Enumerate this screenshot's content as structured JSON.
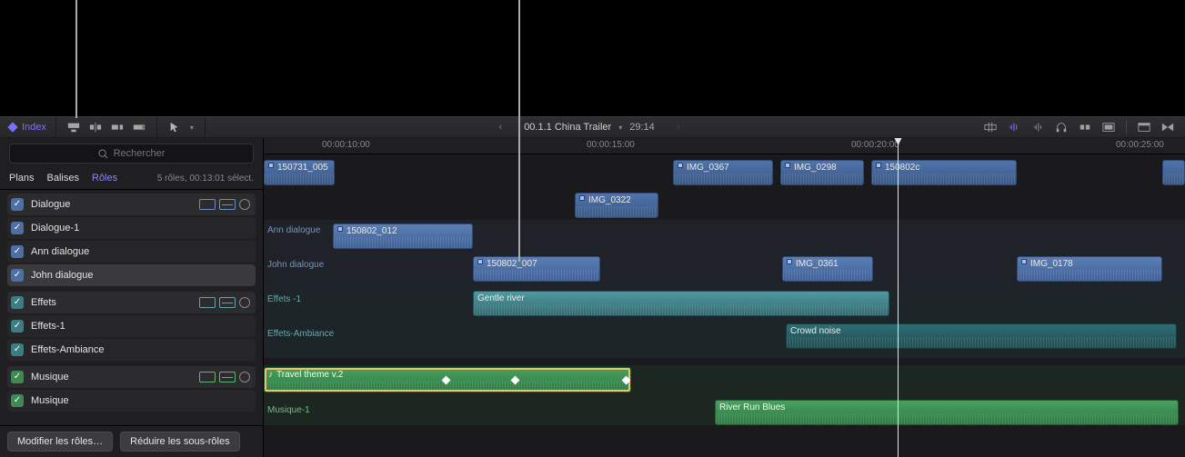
{
  "topbar": {
    "index_label": "Index",
    "prev": "‹",
    "next": "›",
    "title": "00.1.1 China Trailer",
    "timecode": "29:14"
  },
  "search": {
    "placeholder": "Rechercher"
  },
  "tabs": {
    "plans": "Plans",
    "balises": "Balises",
    "roles": "Rôles",
    "info": "5 rôles, 00:13:01 sélect."
  },
  "roles": {
    "dialogue": {
      "label": "Dialogue"
    },
    "dialogue_1": {
      "label": "Dialogue-1"
    },
    "ann": {
      "label": "Ann dialogue"
    },
    "john": {
      "label": "John dialogue"
    },
    "effets": {
      "label": "Effets"
    },
    "effets_1": {
      "label": "Effets-1"
    },
    "effets_amb": {
      "label": "Effets-Ambiance"
    },
    "musique": {
      "label": "Musique"
    },
    "musique_sub": {
      "label": "Musique"
    }
  },
  "footer": {
    "edit_roles": "Modifier les rôles…",
    "collapse_subroles": "Réduire les sous-rôles"
  },
  "ruler": {
    "t1": "00:00:10:00",
    "t2": "00:00:15:00",
    "t3": "00:00:20:00",
    "t4": "00:00:25:00"
  },
  "lane_labels": {
    "ann": "Ann dialogue",
    "john": "John dialogue",
    "fx1": "Effets -1",
    "fx_amb": "Effets-Ambiance",
    "mus1": "Musique-1"
  },
  "clips": {
    "v1": "150731_005",
    "v2": "IMG_0367",
    "v3": "IMG_0298",
    "v4": "150802c",
    "v5": "IMG_0322",
    "d1": "150802_012",
    "d2": "150802_007",
    "d3": "IMG_0361",
    "d4": "IMG_0178",
    "fx1": "Gentle river",
    "fx2": "Crowd noise",
    "m1": "Travel theme v.2",
    "m2": "River Run Blues"
  }
}
